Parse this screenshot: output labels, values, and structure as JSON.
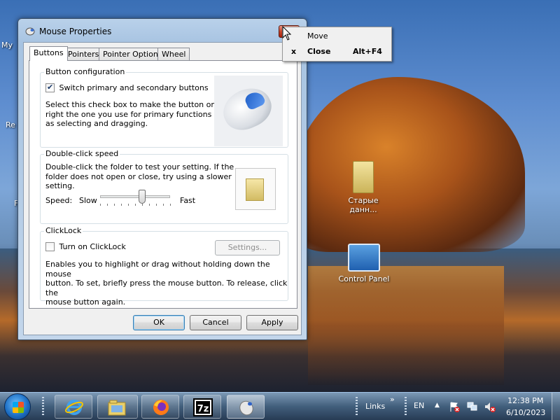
{
  "window": {
    "title": "Mouse Properties",
    "close_glyph": "✕",
    "tabs": [
      {
        "label": "Buttons",
        "active": true
      },
      {
        "label": "Pointers",
        "active": false
      },
      {
        "label": "Pointer Options",
        "active": false
      },
      {
        "label": "Wheel",
        "active": false
      }
    ],
    "button_config": {
      "title": "Button configuration",
      "checkbox_label": "Switch primary and secondary buttons",
      "checked": true,
      "desc_line1": "Select this check box to make the button on the",
      "desc_line2": "right the one you use for primary functions such",
      "desc_line3": "as selecting and dragging."
    },
    "double_click": {
      "title": "Double-click speed",
      "desc_line1": "Double-click the folder to test your setting. If the",
      "desc_line2": "folder does not open or close, try using a slower",
      "desc_line3": "setting.",
      "speed_label": "Speed:",
      "slow_label": "Slow",
      "fast_label": "Fast",
      "speed_fraction": 0.6
    },
    "clicklock": {
      "title": "ClickLock",
      "checkbox_label": "Turn on ClickLock",
      "checked": false,
      "settings_button": "Settings...",
      "desc_line1": "Enables you to highlight or drag without holding down the mouse",
      "desc_line2": "button. To set, briefly press the mouse button. To release, click the",
      "desc_line3": "mouse button again."
    },
    "buttons": {
      "ok": "OK",
      "cancel": "Cancel",
      "apply": "Apply"
    }
  },
  "context_menu": {
    "items": [
      {
        "marker": "",
        "label": "Move",
        "accelerator": ""
      },
      {
        "marker": "x",
        "label": "Close",
        "accelerator": "Alt+F4"
      }
    ]
  },
  "desktop": {
    "icons": [
      {
        "label": "Старые данн...",
        "icon": "folder-icon"
      },
      {
        "label": "Control Panel",
        "icon": "control-panel-icon"
      }
    ],
    "partial_labels": {
      "my": "My",
      "re": "Re",
      "f": "F"
    }
  },
  "taskbar": {
    "links_label": "Links",
    "links_chevron": "»",
    "language": "EN",
    "tray_arrow": "▲",
    "time": "12:38 PM",
    "date": "6/10/2023",
    "apps": [
      "internet-explorer-icon",
      "file-explorer-icon",
      "firefox-icon",
      "7zip-icon",
      "mouse-properties-icon"
    ],
    "sevenzip_text": "7z"
  },
  "colors": {
    "close_red": "#c7462c",
    "selection_blue": "#3c7fb1",
    "firefox_orange": "#ff7a18"
  }
}
